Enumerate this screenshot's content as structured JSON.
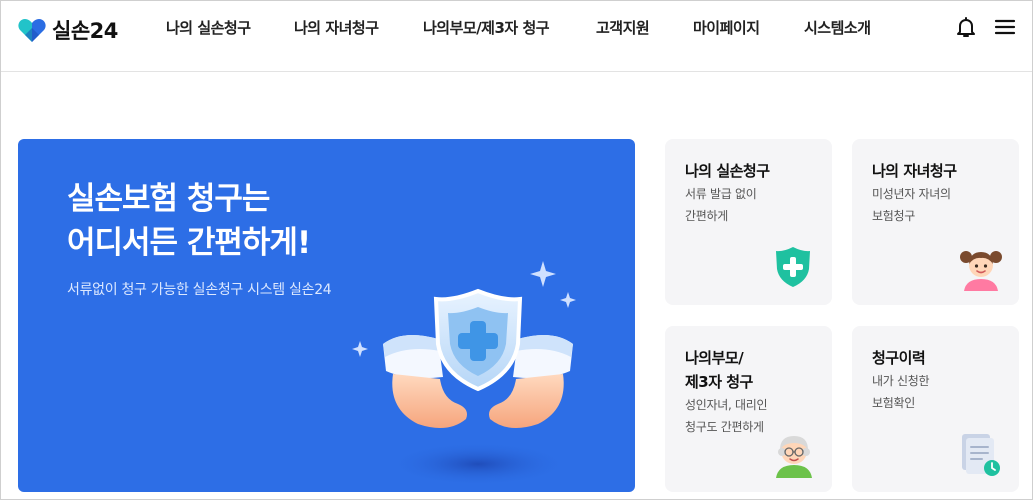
{
  "header": {
    "logo_text": "실손24",
    "nav": [
      {
        "label": "나의 실손청구"
      },
      {
        "label": "나의 자녀청구"
      },
      {
        "label": "나의부모/제3자 청구"
      },
      {
        "label": "고객지원"
      },
      {
        "label": "마이페이지"
      },
      {
        "label": "시스템소개"
      }
    ],
    "icons": [
      "bell-icon",
      "hamburger-menu-icon"
    ]
  },
  "hero": {
    "title_line1": "실손보험 청구는",
    "title_line2": "어디서든 간편하게!",
    "subtitle": "서류없이 청구 가능한 실손청구 시스템 실손24",
    "illustration": "hands-holding-shield-illustration"
  },
  "cards": [
    {
      "title_line1": "나의 실손청구",
      "title_line2": "",
      "desc_line1": "서류 발급 없이",
      "desc_line2": "간편하게",
      "icon": "green-shield-cross-icon"
    },
    {
      "title_line1": "나의 자녀청구",
      "title_line2": "",
      "desc_line1": "미성년자 자녀의",
      "desc_line2": "보험청구",
      "icon": "girl-child-icon"
    },
    {
      "title_line1": "나의부모/",
      "title_line2": "제3자 청구",
      "desc_line1": "성인자녀, 대리인",
      "desc_line2": "청구도 간편하게",
      "icon": "grandparent-icon"
    },
    {
      "title_line1": "청구이력",
      "title_line2": "",
      "desc_line1": "내가 신청한",
      "desc_line2": "보험확인",
      "icon": "document-clock-icon"
    }
  ],
  "colors": {
    "hero_bg": "#2d6ee6",
    "card_bg": "#f5f5f7",
    "shield_green": "#1fc1a0",
    "logo_blue": "#2b6de3",
    "logo_teal": "#22c3c9"
  }
}
